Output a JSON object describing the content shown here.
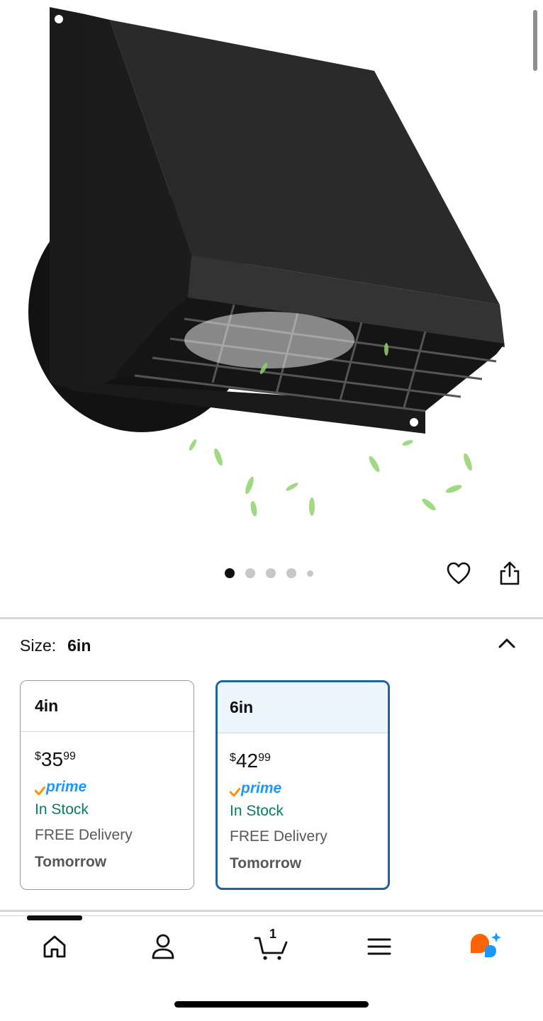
{
  "gallery": {
    "image_alt": "Black wall vent hood with louvered grille",
    "dot_count": 5,
    "active_index": 0
  },
  "actions": {
    "wishlist_icon": "heart-icon",
    "share_icon": "share-icon"
  },
  "size": {
    "label": "Size:",
    "selected": "6in",
    "collapse_icon": "chevron-up-icon",
    "options": [
      {
        "name": "4in",
        "price_symbol": "$",
        "price_whole": "35",
        "price_fraction": "99",
        "prime": "prime",
        "stock": "In Stock",
        "delivery": "FREE Delivery",
        "delivery_day": "Tomorrow"
      },
      {
        "name": "6in",
        "price_symbol": "$",
        "price_whole": "42",
        "price_fraction": "99",
        "prime": "prime",
        "stock": "In Stock",
        "delivery": "FREE Delivery",
        "delivery_day": "Tomorrow"
      }
    ]
  },
  "nav": {
    "items": [
      "home-icon",
      "account-icon",
      "cart-icon",
      "menu-icon",
      "assistant-icon"
    ],
    "cart_count": "1"
  },
  "colors": {
    "accent": "#2162a1",
    "prime": "#1a98ff",
    "stock": "#067d62",
    "assistant_orange": "#ff6200",
    "assistant_blue": "#1a98ff"
  }
}
